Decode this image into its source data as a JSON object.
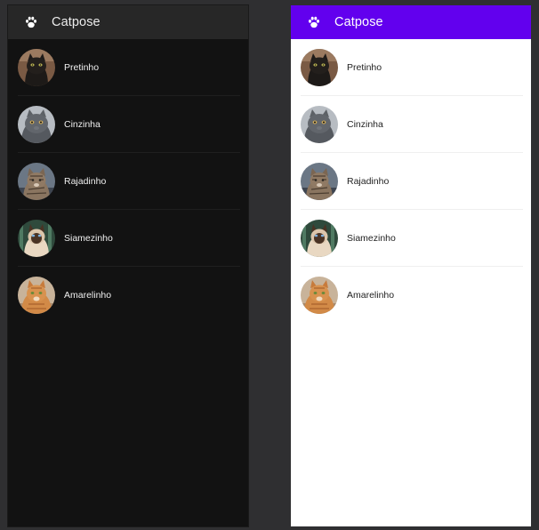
{
  "app": {
    "title": "Catpose",
    "icon": "paw-icon"
  },
  "themes": {
    "dark": {
      "appbar": "#272727",
      "background": "#121212"
    },
    "light": {
      "appbar": "#6200ee",
      "background": "#ffffff"
    }
  },
  "cats": [
    {
      "name": "Pretinho",
      "fur": "black"
    },
    {
      "name": "Cinzinha",
      "fur": "grey"
    },
    {
      "name": "Rajadinho",
      "fur": "tabby"
    },
    {
      "name": "Siamezinho",
      "fur": "siamese"
    },
    {
      "name": "Amarelinho",
      "fur": "orange"
    }
  ]
}
